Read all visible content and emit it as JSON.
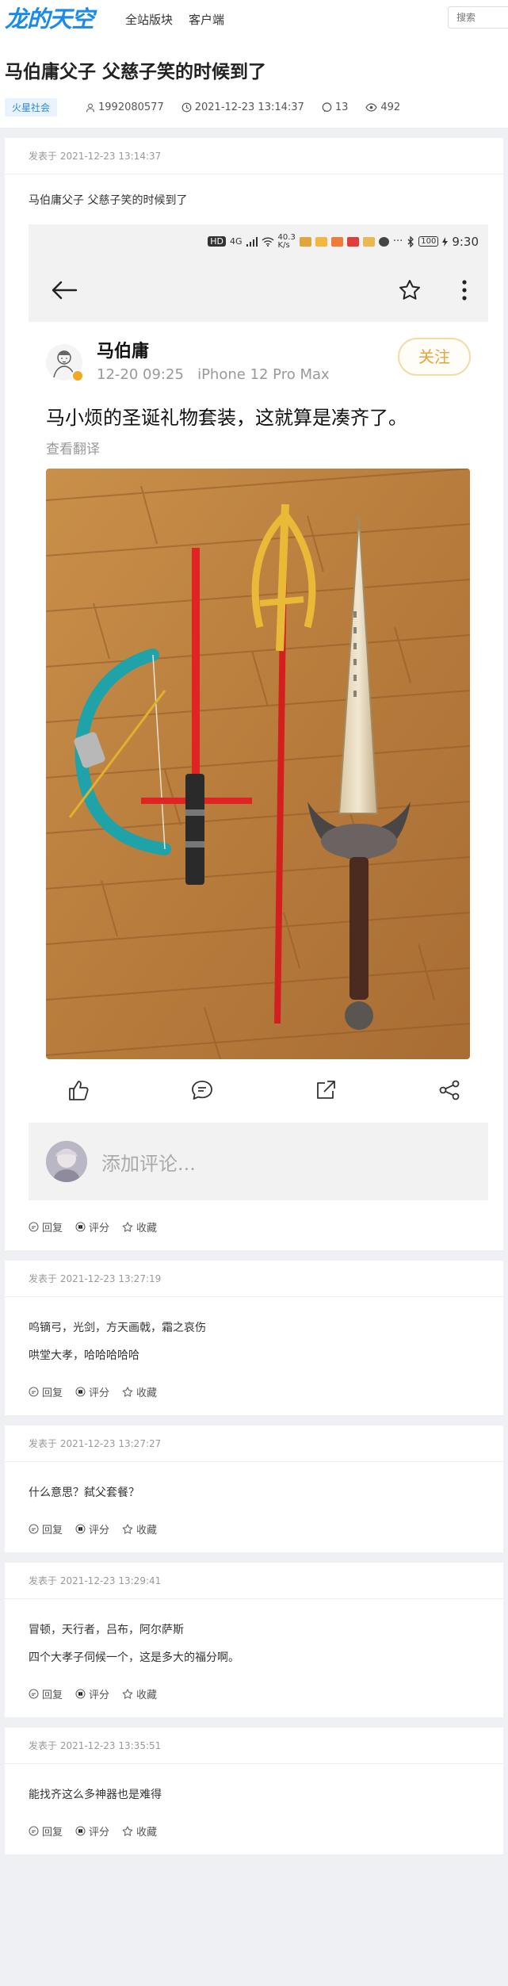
{
  "site": {
    "logo_text": "龙的天空",
    "nav": [
      "全站版块",
      "客户端"
    ],
    "search_placeholder": "搜索"
  },
  "thread": {
    "title": "马伯庸父子 父慈子笑的时候到了",
    "board": "火星社会",
    "author_id": "1992080577",
    "datetime": "2021-12-23 13:14:37",
    "replies": "13",
    "views": "492"
  },
  "actions": {
    "reply": "回复",
    "rate": "评分",
    "favorite": "收藏"
  },
  "first_post": {
    "time": "发表于 2021-12-23 13:14:37",
    "text": "马伯庸父子 父慈子笑的时候到了",
    "screenshot": {
      "status_bar": {
        "network": "4G",
        "speed": "40.3",
        "speed_unit": "K/s",
        "battery": "100",
        "clock": "9:30"
      },
      "author_name": "马伯庸",
      "meta": "12-20 09:25   iPhone 12 Pro Max",
      "follow_label": "关注",
      "body": "马小烦的圣诞礼物套装，这就算是凑齐了。",
      "translate_label": "查看翻译",
      "comment_placeholder": "添加评论..."
    }
  },
  "replies": [
    {
      "time": "发表于 2021-12-23 13:27:19",
      "lines": [
        "呜镝弓，光剑，方天画戟，霜之哀伤",
        "哄堂大孝，哈哈哈哈哈"
      ]
    },
    {
      "time": "发表于 2021-12-23 13:27:27",
      "lines": [
        "什么意思？弑父套餐？"
      ]
    },
    {
      "time": "发表于 2021-12-23 13:29:41",
      "lines": [
        "冒顿，天行者，吕布，阿尔萨斯",
        "四个大孝子伺候一个，这是多大的福分啊。"
      ]
    },
    {
      "time": "发表于 2021-12-23 13:35:51",
      "lines": [
        "能找齐这么多神器也是难得"
      ]
    }
  ],
  "colors": {
    "brand": "#1a8be8",
    "follow": "#e9a23b",
    "tag_bg": "#e8f3fd"
  }
}
